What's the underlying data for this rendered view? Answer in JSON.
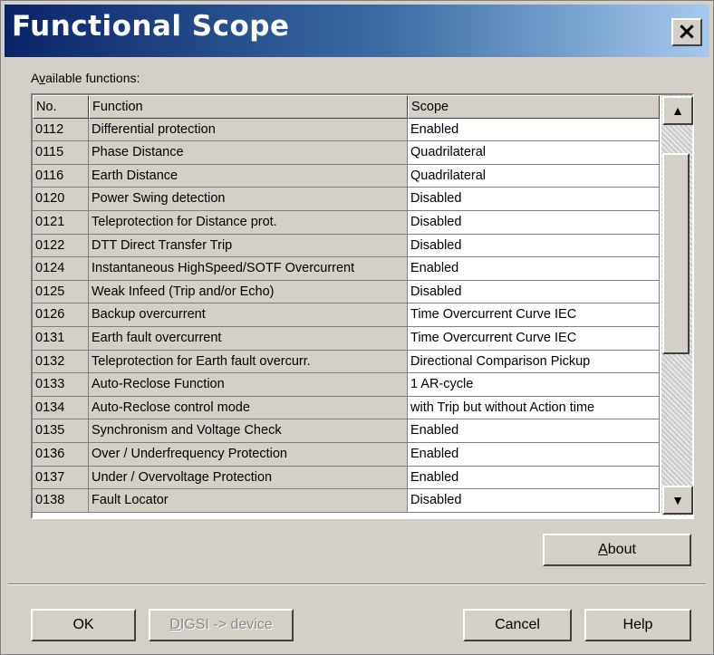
{
  "window": {
    "title": "Functional Scope",
    "close_label": "×"
  },
  "list": {
    "label_prefix": "A",
    "label_accel": "v",
    "label_rest": "ailable functions:",
    "headers": {
      "no": "No.",
      "function": "Function",
      "scope": "Scope"
    },
    "rows": [
      {
        "no": "0112",
        "function": "Differential protection",
        "scope": "Enabled"
      },
      {
        "no": "0115",
        "function": "Phase Distance",
        "scope": "Quadrilateral"
      },
      {
        "no": "0116",
        "function": "Earth Distance",
        "scope": "Quadrilateral"
      },
      {
        "no": "0120",
        "function": "Power Swing detection",
        "scope": "Disabled"
      },
      {
        "no": "0121",
        "function": "Teleprotection for Distance prot.",
        "scope": "Disabled"
      },
      {
        "no": "0122",
        "function": "DTT Direct Transfer Trip",
        "scope": "Disabled"
      },
      {
        "no": "0124",
        "function": "Instantaneous HighSpeed/SOTF Overcurrent",
        "scope": "Enabled"
      },
      {
        "no": "0125",
        "function": "Weak Infeed (Trip and/or Echo)",
        "scope": "Disabled"
      },
      {
        "no": "0126",
        "function": "Backup overcurrent",
        "scope": "Time Overcurrent Curve IEC"
      },
      {
        "no": "0131",
        "function": "Earth fault overcurrent",
        "scope": "Time Overcurrent Curve IEC"
      },
      {
        "no": "0132",
        "function": "Teleprotection for Earth fault overcurr.",
        "scope": "Directional Comparison Pickup"
      },
      {
        "no": "0133",
        "function": "Auto-Reclose Function",
        "scope": "1 AR-cycle"
      },
      {
        "no": "0134",
        "function": "Auto-Reclose control mode",
        "scope": "with Trip but without Action time"
      },
      {
        "no": "0135",
        "function": "Synchronism and Voltage Check",
        "scope": "Enabled"
      },
      {
        "no": "0136",
        "function": "Over / Underfrequency Protection",
        "scope": "Enabled"
      },
      {
        "no": "0137",
        "function": "Under / Overvoltage Protection",
        "scope": "Enabled"
      },
      {
        "no": "0138",
        "function": "Fault Locator",
        "scope": "Disabled"
      }
    ],
    "scroll_up": "▲",
    "scroll_down": "▼"
  },
  "buttons": {
    "about_accel": "A",
    "about_rest": "bout",
    "ok": "OK",
    "digsi_accel": "D",
    "digsi_rest": "IGSI -> device",
    "cancel": "Cancel",
    "help": "Help"
  }
}
